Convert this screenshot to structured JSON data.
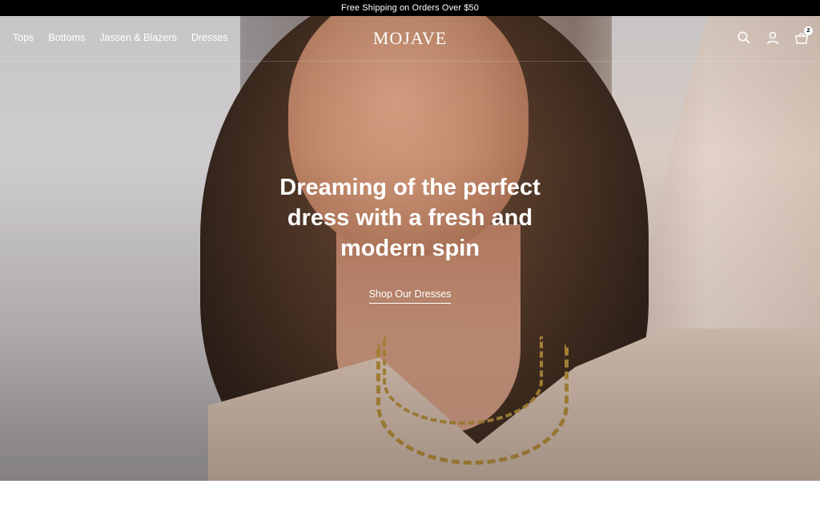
{
  "announcement": {
    "text": "Free Shipping on Orders Over $50"
  },
  "header": {
    "nav": [
      {
        "label": "Tops"
      },
      {
        "label": "Bottoms"
      },
      {
        "label": "Jassen & Blazers"
      },
      {
        "label": "Dresses"
      }
    ],
    "logo": "MOJAVE",
    "icons": [
      "search-icon",
      "account-icon",
      "cart-icon"
    ],
    "cart_count": "2"
  },
  "hero": {
    "headline_line1": "Dreaming of the perfect",
    "headline_line2": "dress with a fresh and",
    "headline_line3": "modern spin",
    "cta_label": "Shop Our Dresses"
  },
  "colors": {
    "announcement_bg": "#000000",
    "text_on_hero": "#ffffff"
  }
}
